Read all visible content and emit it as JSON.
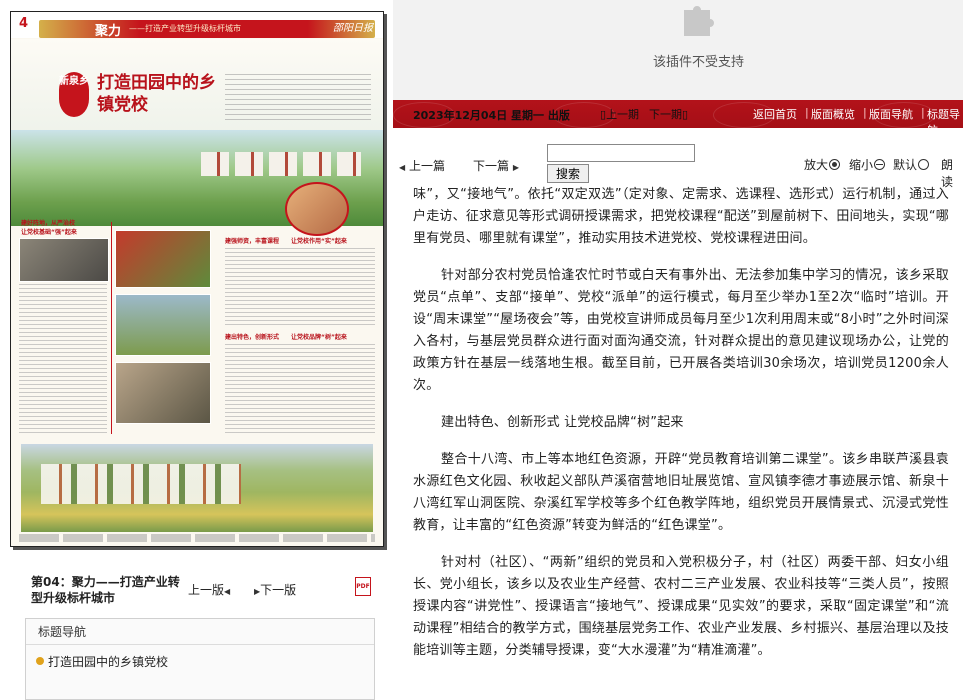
{
  "newspaper": {
    "page_num": "4",
    "section_title": "聚力",
    "section_sub": "——打造产业转型升级标杆城市",
    "masthead": "邵阳日报",
    "badge": "新泉乡",
    "headline": "打造田园中的乡镇党校",
    "sub_1": "建好阵地，从严治校",
    "sub_1b": "让党校基础“强”起来",
    "sub_2": "建强师资，丰富课程",
    "sub_2b": "让党校作用“实”起来",
    "sub_3": "建出特色，创新形式",
    "sub_3b": "让党校品牌“树”起来"
  },
  "page_meta": {
    "label": "第04：聚力——打造产业转型升级标杆城市",
    "prev_page": "上一版",
    "next_page": "下一版",
    "pdf": "PDF"
  },
  "title_nav": {
    "header": "标题导航",
    "items": [
      "打造田园中的乡镇党校"
    ]
  },
  "plugin": {
    "message": "该插件不受支持"
  },
  "top_nav": {
    "date": "2023年12月04日 星期一 出版",
    "prev_issue": "上一期",
    "next_issue": "下一期",
    "links": [
      "返回首页",
      "版面概览",
      "版面导航",
      "标题导航"
    ]
  },
  "toolbar": {
    "prev_article": "上一篇",
    "next_article": "下一篇",
    "search_placeholder": "",
    "search_button": "搜索",
    "zoom_in": "放大",
    "zoom_out": "缩小",
    "zoom_default": "默认",
    "read_aloud": "朗读"
  },
  "article": {
    "paragraphs": [
      "味”，又“接地气”。依托“双定双选”（定对象、定需求、选课程、选形式）运行机制，通过入户走访、征求意见等形式调研授课需求，把党校课程“配送”到屋前树下、田间地头，实现“哪里有党员、哪里就有课堂”，推动实用技术进党校、党校课程进田间。",
      "针对部分农村党员恰逢农忙时节或白天有事外出、无法参加集中学习的情况，该乡采取党员“点单”、支部“接单”、党校“派单”的运行模式，每月至少举办1至2次“临时”培训。开设“周末课堂”“屋场夜会”等，由党校宣讲师成员每月至少1次利用周末或“8小时”之外时间深入各村，与基层党员群众进行面对面沟通交流，针对群众提出的意见建议现场办公，让党的政策方针在基层一线落地生根。截至目前，已开展各类培训30余场次，培训党员1200余人次。",
      "建出特色、创新形式 让党校品牌“树”起来",
      "整合十八湾、市上等本地红色资源，开辟“党员教育培训第二课堂”。该乡串联芦溪县袁水源红色文化园、秋收起义部队芦溪宿营地旧址展览馆、宣风镇李德才事迹展示馆、新泉十八湾红军山洞医院、杂溪红军学校等多个红色教学阵地，组织党员开展情景式、沉浸式党性教育，让丰富的“红色资源”转变为鲜活的“红色课堂”。",
      "针对村（社区）、“两新”组织的党员和入党积极分子，村（社区）两委干部、妇女小组长、党小组长，该乡以及农业生产经营、农村二三产业发展、农业科技等“三类人员”，按照授课内容“讲党性”、授课语言“接地气”、授课成果“见实效”的要求，采取“固定课堂”和“流动课程”相结合的教学方式，围绕基层党务工作、农业产业发展、乡村振兴、基层治理以及技能培训等主题，分类辅导授课，变“大水漫灌”为“精准滴灌”。"
    ]
  },
  "colors": {
    "brand_red": "#b3121a",
    "accent_gold": "#e0a21c"
  }
}
